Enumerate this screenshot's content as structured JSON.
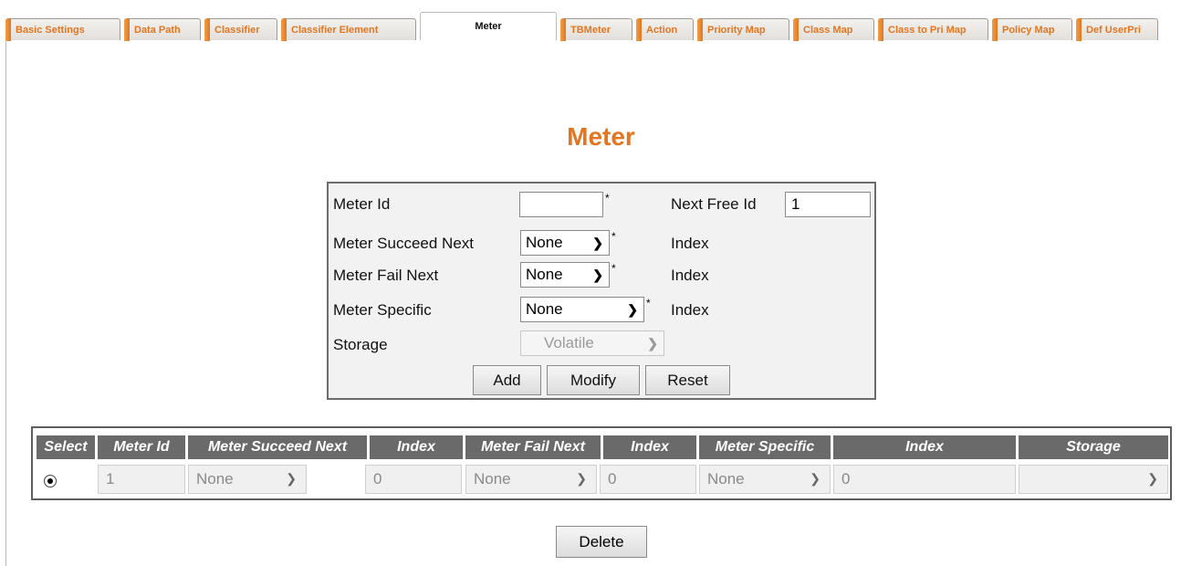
{
  "tabs": [
    {
      "label": "Basic Settings"
    },
    {
      "label": "Data Path"
    },
    {
      "label": "Classifier"
    },
    {
      "label": "Classifier Element"
    },
    {
      "label": "Meter"
    },
    {
      "label": "TBMeter"
    },
    {
      "label": "Action"
    },
    {
      "label": "Priority Map"
    },
    {
      "label": "Class Map"
    },
    {
      "label": "Class to Pri Map"
    },
    {
      "label": "Policy Map"
    },
    {
      "label": "Def UserPri"
    }
  ],
  "active_tab": "Meter",
  "page_title": "Meter",
  "form": {
    "meter_id_label": "Meter Id",
    "meter_id_value": "",
    "next_free_id_label": "Next Free Id",
    "next_free_id_value": "1",
    "succeed_next_label": "Meter Succeed Next",
    "succeed_next_value": "None",
    "fail_next_label": "Meter Fail Next",
    "fail_next_value": "None",
    "specific_label": "Meter Specific",
    "specific_value": "None",
    "index_label": "Index",
    "storage_label": "Storage",
    "storage_value": "Volatile",
    "required_mark": "*",
    "add_label": "Add",
    "modify_label": "Modify",
    "reset_label": "Reset"
  },
  "table": {
    "headers": [
      "Select",
      "Meter Id",
      "Meter Succeed Next",
      "Index",
      "Meter Fail Next",
      "Index",
      "Meter Specific",
      "Index",
      "Storage"
    ],
    "rows": [
      {
        "meter_id": "1",
        "succeed_next": "None",
        "succeed_index": "0",
        "fail_next": "None",
        "fail_index": "0",
        "specific": "None",
        "specific_index": "0",
        "storage": ""
      }
    ]
  },
  "delete_label": "Delete",
  "colors": {
    "accent": "#e4751f",
    "header_bg": "#6a6a6a"
  }
}
